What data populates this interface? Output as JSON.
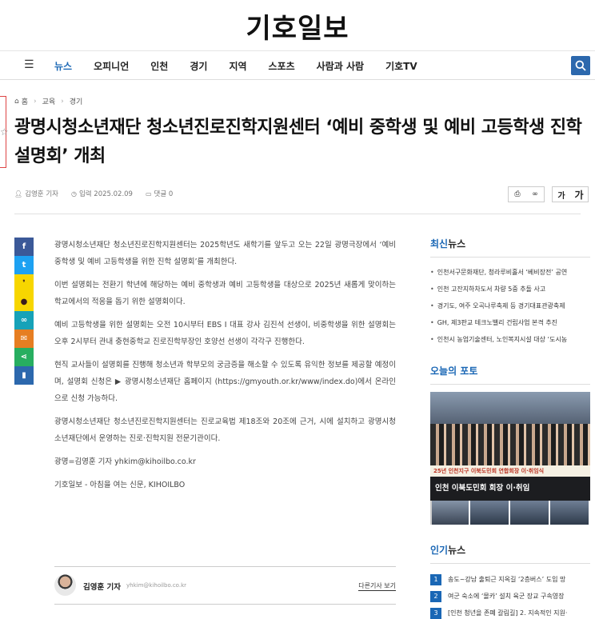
{
  "site": {
    "logo": "기호일보"
  },
  "nav": {
    "items": [
      "뉴스",
      "오피니언",
      "인천",
      "경기",
      "지역",
      "스포츠",
      "사람과 사람",
      "기호TV"
    ],
    "active_index": 0
  },
  "breadcrumb": {
    "home": "홈",
    "level1": "교육",
    "level2": "경기"
  },
  "article": {
    "headline": "광명시청소년재단 청소년진로진학지원센터 ‘예비 중학생 및 예비 고등학생 진학 설명회’ 개최",
    "author": "김영훈 기자",
    "date": "입력 2025.02.09",
    "comments": "댓글 0",
    "font_small": "가",
    "font_large": "가",
    "paragraphs": [
      "광명시청소년재단 청소년진로진학지원센터는 2025학년도 새학기를 앞두고 오는 22일 광명극장에서 ‘예비 중학생 및 예비 고등학생을 위한 진학 설명회’를 개최한다.",
      "이번 설명회는 전환기 학년에 해당하는 예비 중학생과 예비 고등학생을 대상으로 2025년 새롭게 맞이하는 학교에서의 적응을 돕기 위한 설명회이다.",
      "예비 고등학생을 위한 설명회는 오전 10시부터 EBS I 대표 강사 김진석 선생이, 비중학생을 위한 설명회는 오후 2시부터 관내 충현중학교 진로진학부장인 호양선 선생이 각각구 진행한다.",
      "현직 교사들이 설명회를 진행해 청소년과 학부모의 궁금증을 해소할 수 있도록 유익한 정보를 제공할 예정이며, 설명회 신청은 ▶ 광명시청소년재단 홈페이지 (https://gmyouth.or.kr/www/index.do)에서 온라인으로 신청 가능하다.",
      "광명시청소년재단 청소년진로진학지원센터는 진로교육법 제18조와 20조에 근거, 시에 설치하고 광명시청소년재단에서 운영하는 진로·진학지원 전문기관이다.",
      "광명=김영훈 기자 yhkim@kihoilbo.co.kr",
      "기호일보 - 아침을 여는 신문, KIHOILBO"
    ]
  },
  "byline": {
    "name": "김영훈 기자",
    "email": "yhkim@kihoilbo.co.kr",
    "more": "다른기사 보기"
  },
  "sidebar": {
    "latest_title_accent": "최신",
    "latest_title_rest": "뉴스",
    "latest_items": [
      "인천서구문화재단, 청라루비홀서 ‘베비장전’ 공연",
      "인천 고잔지하차도서 차량 5중 추돌 사고",
      "경기도, 여주 오곡나루축제 등 경기대표관광축제",
      "GH, 제3판교 테크노밸리 건립사업 본격 추진",
      "인천시 농업기술센터, 노인복지시설 대상 ‘도시농"
    ],
    "photo_title": "오늘의 포토",
    "photo_banner": "25년 인천지구 이북도민회 연합회장 이·취임식",
    "photo_caption": "인천 이북도민회 회장 이·취임",
    "popular_title_accent": "인기",
    "popular_title_rest": "뉴스",
    "popular_items": [
      {
        "num": "1",
        "text": "송도~강남 출퇴근 지옥길 ‘2층버스’ 도입 망"
      },
      {
        "num": "2",
        "text": "여군 숙소에 ‘몰카’ 설치 육군 장교 구속영장"
      },
      {
        "num": "3",
        "text": "[인천 청년을 존폐 갈림길] 2. 지속적인 지원·"
      }
    ]
  },
  "colors": {
    "accent": "#1a67b5",
    "search": "#2c68ad"
  }
}
